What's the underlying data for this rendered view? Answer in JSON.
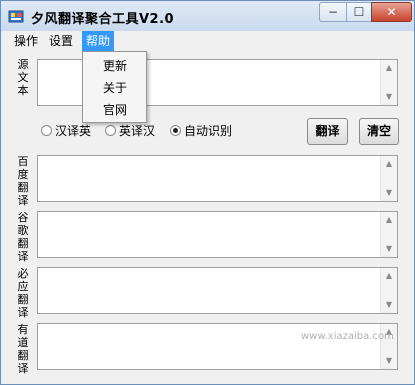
{
  "window": {
    "title": "夕风翻译聚合工具V2.0",
    "controls": {
      "minimize": "−",
      "maximize": "☐",
      "close": "✕"
    }
  },
  "menubar": {
    "items": [
      {
        "label": "操作"
      },
      {
        "label": "设置"
      },
      {
        "label": "帮助",
        "active": true
      }
    ]
  },
  "help_menu": {
    "items": [
      {
        "label": "更新"
      },
      {
        "label": "关于"
      },
      {
        "label": "官网"
      }
    ]
  },
  "source": {
    "label": [
      "源",
      "文",
      "本"
    ],
    "value": ""
  },
  "direction": {
    "options": [
      {
        "label": "汉译英",
        "checked": false
      },
      {
        "label": "英译汉",
        "checked": false
      },
      {
        "label": "自动识别",
        "checked": true
      }
    ]
  },
  "buttons": {
    "translate": "翻译",
    "clear": "清空"
  },
  "results": [
    {
      "label": [
        "百",
        "度",
        "翻",
        "译"
      ],
      "value": ""
    },
    {
      "label": [
        "谷",
        "歌",
        "翻",
        "译"
      ],
      "value": ""
    },
    {
      "label": [
        "必",
        "应",
        "翻",
        "译"
      ],
      "value": ""
    },
    {
      "label": [
        "有",
        "道",
        "翻",
        "译"
      ],
      "value": ""
    }
  ],
  "watermark": "www.xiazaiba.com",
  "scrollbar": {
    "up": "▲",
    "down": "▼"
  }
}
